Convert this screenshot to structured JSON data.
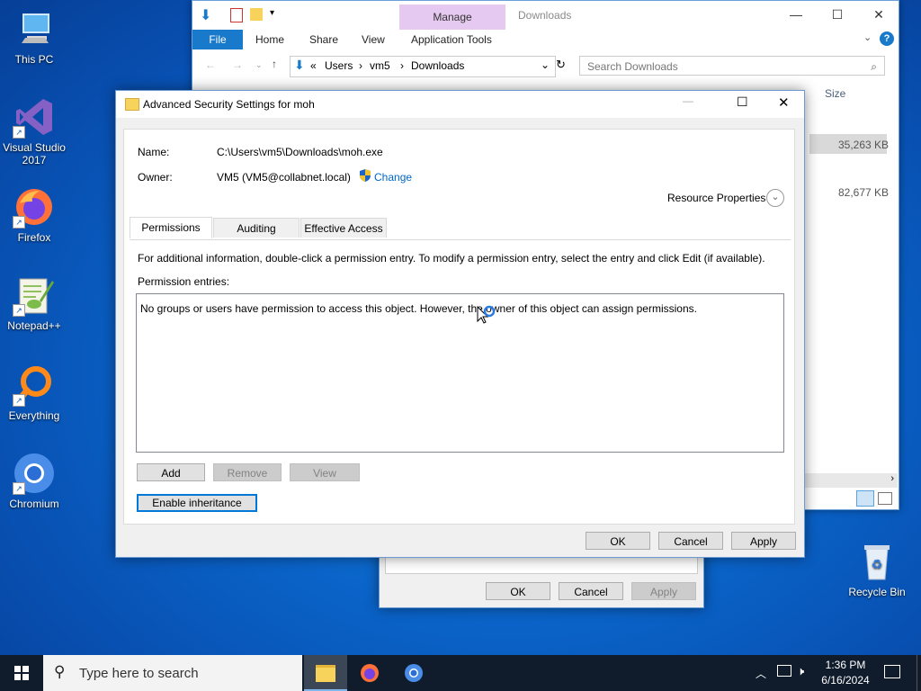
{
  "desktop": {
    "icons": [
      {
        "label": "This PC"
      },
      {
        "label": "Visual Studio\n2017"
      },
      {
        "label": "Firefox"
      },
      {
        "label": "Notepad++"
      },
      {
        "label": "Everything"
      },
      {
        "label": "Chromium"
      },
      {
        "label": "Recycle Bin"
      }
    ]
  },
  "explorer": {
    "title": "Downloads",
    "manage": "Manage",
    "tabs": [
      "File",
      "Home",
      "Share",
      "View",
      "Application Tools"
    ],
    "path": [
      "Users",
      "vm5",
      "Downloads"
    ],
    "path_prefix": "«",
    "search_placeholder": "Search Downloads",
    "col_size": "Size",
    "sizes": [
      "35,263 KB",
      "82,677 KB"
    ]
  },
  "under_dialog": {
    "ok": "OK",
    "cancel": "Cancel",
    "apply": "Apply"
  },
  "dialog": {
    "title": "Advanced Security Settings for moh",
    "name_label": "Name:",
    "name_value": "C:\\Users\\vm5\\Downloads\\moh.exe",
    "owner_label": "Owner:",
    "owner_value": "VM5 (VM5@collabnet.local)",
    "change_link": "Change",
    "resource_properties": "Resource Properties",
    "tabs": [
      "Permissions",
      "Auditing",
      "Effective Access"
    ],
    "info_text": "For additional information, double-click a permission entry. To modify a permission entry, select the entry and click Edit (if available).",
    "entries_label": "Permission entries:",
    "entries_message": "No groups or users have permission to access this object. However, the owner of this object can assign permissions.",
    "add": "Add",
    "remove": "Remove",
    "view": "View",
    "enable_inheritance": "Enable inheritance",
    "ok": "OK",
    "cancel": "Cancel",
    "apply": "Apply"
  },
  "taskbar": {
    "search_placeholder": "Type here to search",
    "time": "1:36 PM",
    "date": "6/16/2024"
  },
  "colors": {
    "accent": "#0078d7",
    "link": "#0066cc",
    "taskbar": "#101c2c"
  }
}
